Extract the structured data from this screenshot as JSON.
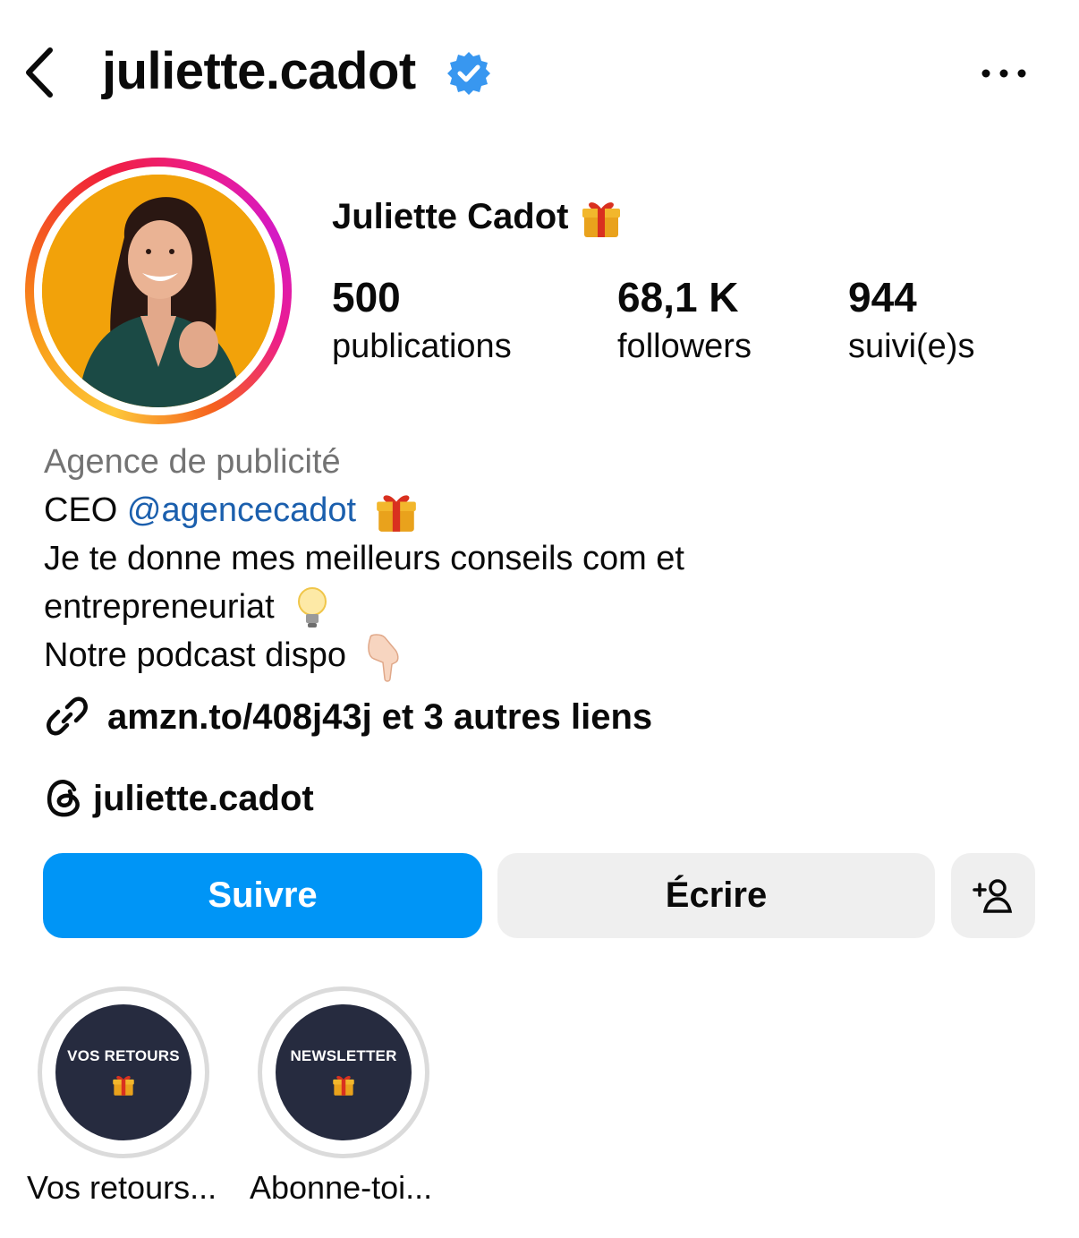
{
  "header": {
    "username": "juliette.cadot"
  },
  "profile": {
    "display_name": "Juliette Cadot",
    "stats": [
      {
        "value": "500",
        "label": "publications"
      },
      {
        "value": "68,1 K",
        "label": "followers"
      },
      {
        "value": "944",
        "label": "suivi(e)s"
      }
    ],
    "category": "Agence de publicité",
    "bio_line1_prefix": "CEO ",
    "bio_line1_mention": "@agencecadot",
    "bio_line2": "Je te donne mes meilleurs conseils com et",
    "bio_line3": "entrepreneuriat",
    "bio_line4": "Notre podcast dispo",
    "link_text": "amzn.to/408j43j et 3 autres liens",
    "threads_handle": "juliette.cadot"
  },
  "actions": {
    "follow_label": "Suivre",
    "message_label": "Écrire"
  },
  "highlights": [
    {
      "cover_text": "VOS RETOURS",
      "label": "Vos retours..."
    },
    {
      "cover_text": "NEWSLETTER",
      "label": "Abonne-toi..."
    }
  ],
  "colors": {
    "follow_button": "#0095f6",
    "verified_badge": "#3897f0",
    "mention": "#1b5fad",
    "category": "#737373",
    "highlight_cover": "#262b3f"
  },
  "icons": {
    "back": "chevron-left-icon",
    "verified": "verified-badge-icon",
    "more": "more-horizontal-icon",
    "link": "link-icon",
    "threads": "threads-icon",
    "add_user": "add-user-icon"
  }
}
